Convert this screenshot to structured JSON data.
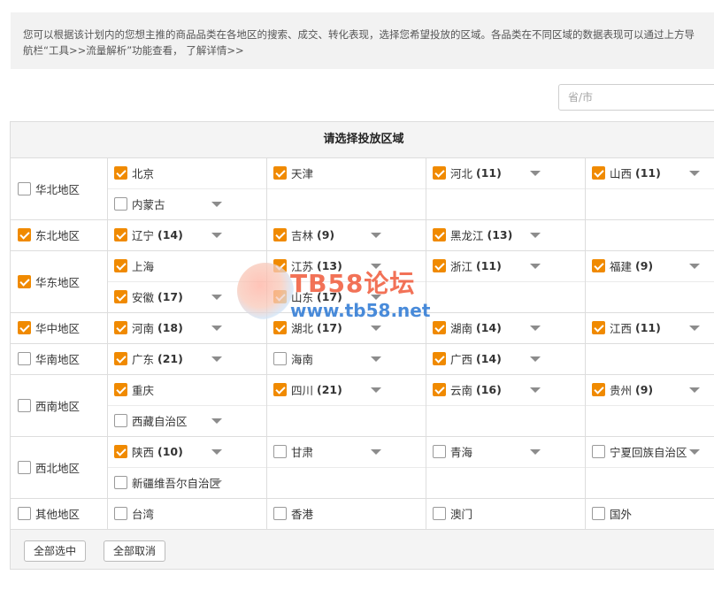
{
  "notice": {
    "line1": "您可以根据该计划内的您想主推的商品品类在各地区的搜索、成交、转化表现，选择您希望投放的区域。各品类在不同区域的数据表现可以通过上方导",
    "line2": "航栏“工具>>流量解析”功能查看， 了解详情>>"
  },
  "search": {
    "placeholder": "省/市"
  },
  "panel": {
    "title": "请选择投放区域"
  },
  "regions": [
    {
      "name": "华北地区",
      "checked": false,
      "provinces": [
        {
          "name": "北京",
          "count": "",
          "checked": true,
          "dropdown": false
        },
        {
          "name": "天津",
          "count": "",
          "checked": true,
          "dropdown": false
        },
        {
          "name": "河北",
          "count": "(11)",
          "checked": true,
          "dropdown": true
        },
        {
          "name": "山西",
          "count": "(11)",
          "checked": true,
          "dropdown": true
        },
        {
          "name": "内蒙古",
          "count": "",
          "checked": false,
          "dropdown": true
        }
      ]
    },
    {
      "name": "东北地区",
      "checked": true,
      "provinces": [
        {
          "name": "辽宁",
          "count": "(14)",
          "checked": true,
          "dropdown": true
        },
        {
          "name": "吉林",
          "count": "(9)",
          "checked": true,
          "dropdown": true
        },
        {
          "name": "黑龙江",
          "count": "(13)",
          "checked": true,
          "dropdown": true
        }
      ]
    },
    {
      "name": "华东地区",
      "checked": true,
      "provinces": [
        {
          "name": "上海",
          "count": "",
          "checked": true,
          "dropdown": false
        },
        {
          "name": "江苏",
          "count": "(13)",
          "checked": true,
          "dropdown": true
        },
        {
          "name": "浙江",
          "count": "(11)",
          "checked": true,
          "dropdown": true
        },
        {
          "name": "福建",
          "count": "(9)",
          "checked": true,
          "dropdown": true
        },
        {
          "name": "安徽",
          "count": "(17)",
          "checked": true,
          "dropdown": true
        },
        {
          "name": "山东",
          "count": "(17)",
          "checked": true,
          "dropdown": true
        }
      ]
    },
    {
      "name": "华中地区",
      "checked": true,
      "provinces": [
        {
          "name": "河南",
          "count": "(18)",
          "checked": true,
          "dropdown": true
        },
        {
          "name": "湖北",
          "count": "(17)",
          "checked": true,
          "dropdown": true
        },
        {
          "name": "湖南",
          "count": "(14)",
          "checked": true,
          "dropdown": true
        },
        {
          "name": "江西",
          "count": "(11)",
          "checked": true,
          "dropdown": true
        }
      ]
    },
    {
      "name": "华南地区",
      "checked": false,
      "provinces": [
        {
          "name": "广东",
          "count": "(21)",
          "checked": true,
          "dropdown": true
        },
        {
          "name": "海南",
          "count": "",
          "checked": false,
          "dropdown": true
        },
        {
          "name": "广西",
          "count": "(14)",
          "checked": true,
          "dropdown": true
        }
      ]
    },
    {
      "name": "西南地区",
      "checked": false,
      "provinces": [
        {
          "name": "重庆",
          "count": "",
          "checked": true,
          "dropdown": false
        },
        {
          "name": "四川",
          "count": "(21)",
          "checked": true,
          "dropdown": true
        },
        {
          "name": "云南",
          "count": "(16)",
          "checked": true,
          "dropdown": true
        },
        {
          "name": "贵州",
          "count": "(9)",
          "checked": true,
          "dropdown": true
        },
        {
          "name": "西藏自治区",
          "count": "",
          "checked": false,
          "dropdown": true
        }
      ]
    },
    {
      "name": "西北地区",
      "checked": false,
      "provinces": [
        {
          "name": "陕西",
          "count": "(10)",
          "checked": true,
          "dropdown": true
        },
        {
          "name": "甘肃",
          "count": "",
          "checked": false,
          "dropdown": true
        },
        {
          "name": "青海",
          "count": "",
          "checked": false,
          "dropdown": true
        },
        {
          "name": "宁夏回族自治区",
          "count": "",
          "checked": false,
          "dropdown": true
        },
        {
          "name": "新疆维吾尔自治区",
          "count": "",
          "checked": false,
          "dropdown": true
        }
      ]
    },
    {
      "name": "其他地区",
      "checked": false,
      "provinces": [
        {
          "name": "台湾",
          "count": "",
          "checked": false,
          "dropdown": false
        },
        {
          "name": "香港",
          "count": "",
          "checked": false,
          "dropdown": false
        },
        {
          "name": "澳门",
          "count": "",
          "checked": false,
          "dropdown": false
        },
        {
          "name": "国外",
          "count": "",
          "checked": false,
          "dropdown": false
        }
      ]
    }
  ],
  "buttons": {
    "select_all": "全部选中",
    "cancel_all": "全部取消"
  },
  "watermark": {
    "title": "TB58论坛",
    "url": "www.tb58.net"
  },
  "colors": {
    "accent": "#f08a00",
    "border": "#dddddd",
    "header_bg": "#f4f4f4"
  }
}
